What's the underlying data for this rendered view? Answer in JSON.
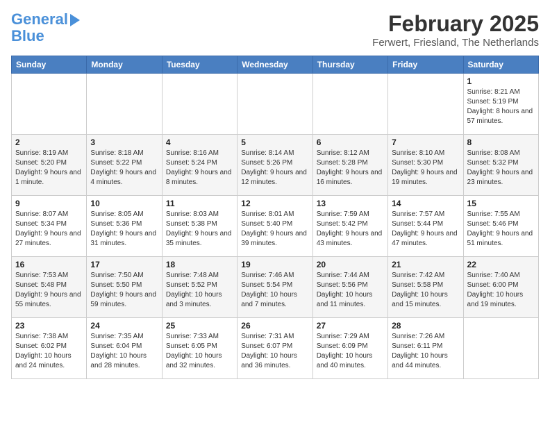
{
  "logo": {
    "line1": "General",
    "line2": "Blue"
  },
  "title": "February 2025",
  "location": "Ferwert, Friesland, The Netherlands",
  "days_header": [
    "Sunday",
    "Monday",
    "Tuesday",
    "Wednesday",
    "Thursday",
    "Friday",
    "Saturday"
  ],
  "weeks": [
    [
      {
        "day": "",
        "info": ""
      },
      {
        "day": "",
        "info": ""
      },
      {
        "day": "",
        "info": ""
      },
      {
        "day": "",
        "info": ""
      },
      {
        "day": "",
        "info": ""
      },
      {
        "day": "",
        "info": ""
      },
      {
        "day": "1",
        "info": "Sunrise: 8:21 AM\nSunset: 5:19 PM\nDaylight: 8 hours and 57 minutes."
      }
    ],
    [
      {
        "day": "2",
        "info": "Sunrise: 8:19 AM\nSunset: 5:20 PM\nDaylight: 9 hours and 1 minute."
      },
      {
        "day": "3",
        "info": "Sunrise: 8:18 AM\nSunset: 5:22 PM\nDaylight: 9 hours and 4 minutes."
      },
      {
        "day": "4",
        "info": "Sunrise: 8:16 AM\nSunset: 5:24 PM\nDaylight: 9 hours and 8 minutes."
      },
      {
        "day": "5",
        "info": "Sunrise: 8:14 AM\nSunset: 5:26 PM\nDaylight: 9 hours and 12 minutes."
      },
      {
        "day": "6",
        "info": "Sunrise: 8:12 AM\nSunset: 5:28 PM\nDaylight: 9 hours and 16 minutes."
      },
      {
        "day": "7",
        "info": "Sunrise: 8:10 AM\nSunset: 5:30 PM\nDaylight: 9 hours and 19 minutes."
      },
      {
        "day": "8",
        "info": "Sunrise: 8:08 AM\nSunset: 5:32 PM\nDaylight: 9 hours and 23 minutes."
      }
    ],
    [
      {
        "day": "9",
        "info": "Sunrise: 8:07 AM\nSunset: 5:34 PM\nDaylight: 9 hours and 27 minutes."
      },
      {
        "day": "10",
        "info": "Sunrise: 8:05 AM\nSunset: 5:36 PM\nDaylight: 9 hours and 31 minutes."
      },
      {
        "day": "11",
        "info": "Sunrise: 8:03 AM\nSunset: 5:38 PM\nDaylight: 9 hours and 35 minutes."
      },
      {
        "day": "12",
        "info": "Sunrise: 8:01 AM\nSunset: 5:40 PM\nDaylight: 9 hours and 39 minutes."
      },
      {
        "day": "13",
        "info": "Sunrise: 7:59 AM\nSunset: 5:42 PM\nDaylight: 9 hours and 43 minutes."
      },
      {
        "day": "14",
        "info": "Sunrise: 7:57 AM\nSunset: 5:44 PM\nDaylight: 9 hours and 47 minutes."
      },
      {
        "day": "15",
        "info": "Sunrise: 7:55 AM\nSunset: 5:46 PM\nDaylight: 9 hours and 51 minutes."
      }
    ],
    [
      {
        "day": "16",
        "info": "Sunrise: 7:53 AM\nSunset: 5:48 PM\nDaylight: 9 hours and 55 minutes."
      },
      {
        "day": "17",
        "info": "Sunrise: 7:50 AM\nSunset: 5:50 PM\nDaylight: 9 hours and 59 minutes."
      },
      {
        "day": "18",
        "info": "Sunrise: 7:48 AM\nSunset: 5:52 PM\nDaylight: 10 hours and 3 minutes."
      },
      {
        "day": "19",
        "info": "Sunrise: 7:46 AM\nSunset: 5:54 PM\nDaylight: 10 hours and 7 minutes."
      },
      {
        "day": "20",
        "info": "Sunrise: 7:44 AM\nSunset: 5:56 PM\nDaylight: 10 hours and 11 minutes."
      },
      {
        "day": "21",
        "info": "Sunrise: 7:42 AM\nSunset: 5:58 PM\nDaylight: 10 hours and 15 minutes."
      },
      {
        "day": "22",
        "info": "Sunrise: 7:40 AM\nSunset: 6:00 PM\nDaylight: 10 hours and 19 minutes."
      }
    ],
    [
      {
        "day": "23",
        "info": "Sunrise: 7:38 AM\nSunset: 6:02 PM\nDaylight: 10 hours and 24 minutes."
      },
      {
        "day": "24",
        "info": "Sunrise: 7:35 AM\nSunset: 6:04 PM\nDaylight: 10 hours and 28 minutes."
      },
      {
        "day": "25",
        "info": "Sunrise: 7:33 AM\nSunset: 6:05 PM\nDaylight: 10 hours and 32 minutes."
      },
      {
        "day": "26",
        "info": "Sunrise: 7:31 AM\nSunset: 6:07 PM\nDaylight: 10 hours and 36 minutes."
      },
      {
        "day": "27",
        "info": "Sunrise: 7:29 AM\nSunset: 6:09 PM\nDaylight: 10 hours and 40 minutes."
      },
      {
        "day": "28",
        "info": "Sunrise: 7:26 AM\nSunset: 6:11 PM\nDaylight: 10 hours and 44 minutes."
      },
      {
        "day": "",
        "info": ""
      }
    ]
  ]
}
